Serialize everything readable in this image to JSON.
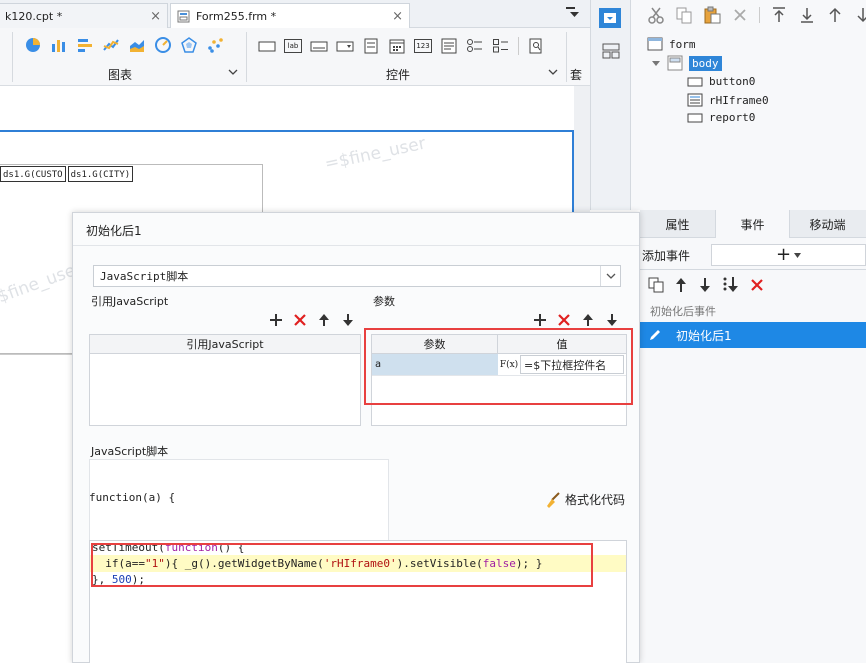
{
  "tabs": [
    {
      "label": "k120.cpt *",
      "close": "×"
    },
    {
      "label": "Form255.frm *",
      "close": "×"
    }
  ],
  "ribbon": {
    "group_chart_label": "图表",
    "group_widget_label": "控件",
    "group_set_label": "套用",
    "widget_lab": "lab",
    "widget_123": "123"
  },
  "tree": {
    "root": "form",
    "body": "body",
    "children": [
      "button0",
      "rHIframe0",
      "report0"
    ]
  },
  "prop_tabs": {
    "properties": "属性",
    "events": "事件",
    "mobile": "移动端"
  },
  "events_panel": {
    "add_event_label": "添加事件",
    "add_glyph": "+",
    "category": "初始化后事件",
    "selected_event": "初始化后1"
  },
  "canvas": {
    "cell1": "ds1.G(CUSTO",
    "cell2": "ds1.G(CITY)",
    "watermark1": "=$fine_user",
    "watermark2": "$fine_use"
  },
  "dialog": {
    "title": "初始化后1",
    "type_select": "JavaScript脚本",
    "ref_js_section": "引用JavaScript",
    "params_section": "参数",
    "ref_js_header": "引用JavaScript",
    "param_header": "参数",
    "value_header": "值",
    "param_name": "a",
    "param_value": "=$下拉框控件名",
    "formula_glyph": "F(x)",
    "js_section": "JavaScript脚本",
    "func_signature": "function(a) {",
    "format_code": "格式化代码",
    "code_line1_pre": "setTimeout(",
    "code_line1_kw": "function",
    "code_line1_post": "() {",
    "code_line2_a": "  if(a==",
    "code_line2_str": "\"1\"",
    "code_line2_b": "){ _g().getWidgetByName(",
    "code_line2_str2": "'rHIframe0'",
    "code_line2_c": ").setVisible(",
    "code_line2_kw": "false",
    "code_line2_d": "); }",
    "code_line3_a": "}, ",
    "code_line3_num": "500",
    "code_line3_b": ");"
  },
  "colors": {
    "accent": "#2f7fd6",
    "selected_row": "#1e88e5",
    "highlight_box": "#e84040",
    "code_highlight": "#fffbc4"
  }
}
